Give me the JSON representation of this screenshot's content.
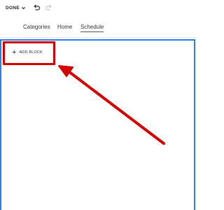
{
  "toolbar": {
    "done_label": "DONE",
    "icons": {
      "done_menu": "chevron-down-icon",
      "undo": "undo-icon",
      "redo": "redo-icon"
    }
  },
  "nav": {
    "items": [
      "Categories",
      "Home",
      "Schedule"
    ],
    "active": "Schedule"
  },
  "editor": {
    "add_block_label": "ADD BLOCK",
    "add_block_icon": "plus-icon",
    "frame_color": "#2b7de9"
  },
  "annotation": {
    "color": "#d40000",
    "shapes": [
      "highlight-box",
      "pointer-arrow"
    ]
  }
}
